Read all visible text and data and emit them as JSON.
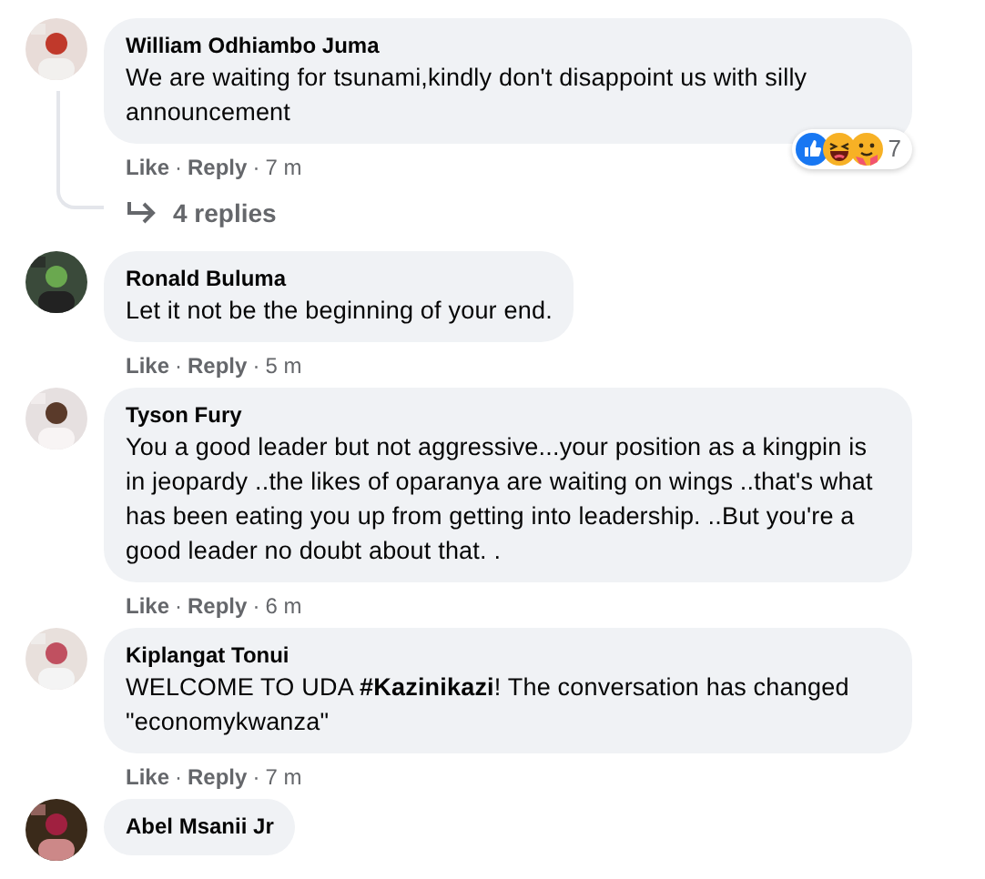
{
  "comments": [
    {
      "name": "William Odhiambo Juma",
      "body": "We are waiting for tsunami,kindly don't disappoint us with silly announcement",
      "like": "Like",
      "sep1": "·",
      "reply": "Reply",
      "sep2": "·",
      "time": "7 m",
      "reactions": {
        "count": "7"
      },
      "replies": "4 replies"
    },
    {
      "name": "Ronald Buluma",
      "body": "Let it not be the beginning of your end.",
      "like": "Like",
      "sep1": "·",
      "reply": "Reply",
      "sep2": "·",
      "time": "5 m"
    },
    {
      "name": "Tyson Fury",
      "body": "You a good leader but not aggressive...your position as a kingpin is in jeopardy ..the likes of oparanya are waiting on wings ..that's what has been eating you up from getting into leadership. ..But you're a good leader no doubt about that. .",
      "like": "Like",
      "sep1": "·",
      "reply": "Reply",
      "sep2": "·",
      "time": "6 m"
    },
    {
      "name": "Kiplangat Tonui",
      "body": "WELCOME TO UDA **#Kazinikazi**! The conversation has changed \"economykwanza\"",
      "like": "Like",
      "sep1": "·",
      "reply": "Reply",
      "sep2": "·",
      "time": "7 m"
    },
    {
      "name": "Abel Msanii Jr"
    }
  ]
}
